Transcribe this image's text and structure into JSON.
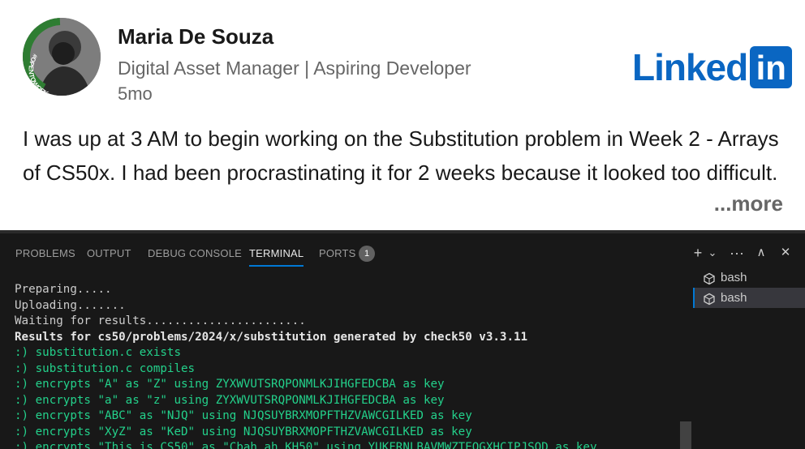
{
  "post": {
    "author_name": "Maria De Souza",
    "author_headline": "Digital Asset Manager | Aspiring Developer",
    "post_age": "5mo",
    "avatar_badge": "#OPENTOWORK",
    "brand": {
      "word": "Linked",
      "box": "in",
      "color": "#0a66c2"
    },
    "body": "I was up at 3 AM to begin working on the Substitution problem in Week 2 - Arrays of CS50x. I had been procrastinating it for 2 weeks because it looked too difficult.",
    "more_label": "...more"
  },
  "panel": {
    "tabs": [
      {
        "label": "PROBLEMS",
        "active": false
      },
      {
        "label": "OUTPUT",
        "active": false
      },
      {
        "label": "DEBUG CONSOLE",
        "active": false
      },
      {
        "label": "TERMINAL",
        "active": true
      },
      {
        "label": "PORTS",
        "active": false
      }
    ],
    "ports_badge": "1",
    "actions": {
      "new_terminal": "+",
      "dropdown": "⌄",
      "more": "···",
      "maximize": "∧",
      "close": "✕"
    },
    "shells": [
      {
        "label": "bash",
        "active": false
      },
      {
        "label": "bash",
        "active": true
      }
    ],
    "terminal_lines": [
      {
        "text": "Preparing.....",
        "style": "normal"
      },
      {
        "text": "Uploading.......",
        "style": "normal"
      },
      {
        "text": "Waiting for results.......................",
        "style": "normal"
      },
      {
        "text": "Results for cs50/problems/2024/x/substitution generated by check50 v3.3.11",
        "style": "bold"
      },
      {
        "text": ":) substitution.c exists",
        "style": "pass"
      },
      {
        "text": ":) substitution.c compiles",
        "style": "pass"
      },
      {
        "text": ":) encrypts \"A\" as \"Z\" using ZYXWVUTSRQPONMLKJIHGFEDCBA as key",
        "style": "pass"
      },
      {
        "text": ":) encrypts \"a\" as \"z\" using ZYXWVUTSRQPONMLKJIHGFEDCBA as key",
        "style": "pass"
      },
      {
        "text": ":) encrypts \"ABC\" as \"NJQ\" using NJQSUYBRXMOPFTHZVAWCGILKED as key",
        "style": "pass"
      },
      {
        "text": ":) encrypts \"XyZ\" as \"KeD\" using NJQSUYBRXMOPFTHZVAWCGILKED as key",
        "style": "pass"
      },
      {
        "text": ":) encrypts \"This is CS50\" as \"Cbah ah KH50\" using YUKFRNLBAVMWZTEOGXHCIPJSQD as key",
        "style": "pass"
      }
    ]
  }
}
